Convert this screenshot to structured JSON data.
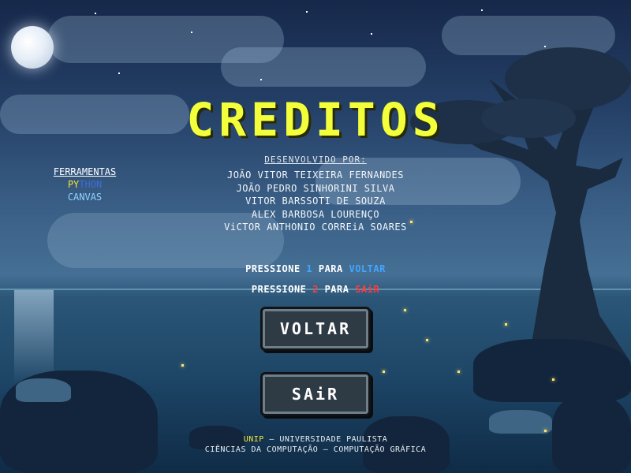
{
  "title": "CREDITOS",
  "developers": {
    "heading": "DESENVOLVIDO POR:",
    "names": [
      "JOÃO VITOR TEIXEIRA FERNANDES",
      "JOÃO PEDRO SINHORINI SILVA",
      "VITOR BARSSOTI DE SOUZA",
      "ALEX BARBOSA LOURENÇO",
      "ViCTOR ANTHONIO CORREiA SOARES"
    ]
  },
  "tools": {
    "heading": "FERRAMENTAS",
    "python_part1": "PY",
    "python_part2": "THON",
    "canvas": "CANVAS"
  },
  "prompts": {
    "back": {
      "prefix": "PRESSIONE ",
      "key": "1",
      "middle": " PARA ",
      "action": "VOLTAR"
    },
    "exit": {
      "prefix": "PRESSIONE ",
      "key": "2",
      "middle": " PARA ",
      "action": "SAiR"
    }
  },
  "buttons": {
    "back_label": "VOLTAR",
    "exit_label": "SAiR"
  },
  "footer": {
    "unip": "UNIP",
    "university": " – UNIVERSIDADE PAULISTA",
    "course": "CIÊNCIAS DA COMPUTAÇÃO – COMPUTAÇÃO GRÁFICA"
  },
  "colors": {
    "title": "#f3ff3a",
    "key_back": "#43a6ff",
    "key_exit": "#ff3c3c",
    "python_yellow": "#f3e233",
    "python_blue": "#3c6fd8",
    "canvas": "#8fd1ff"
  }
}
